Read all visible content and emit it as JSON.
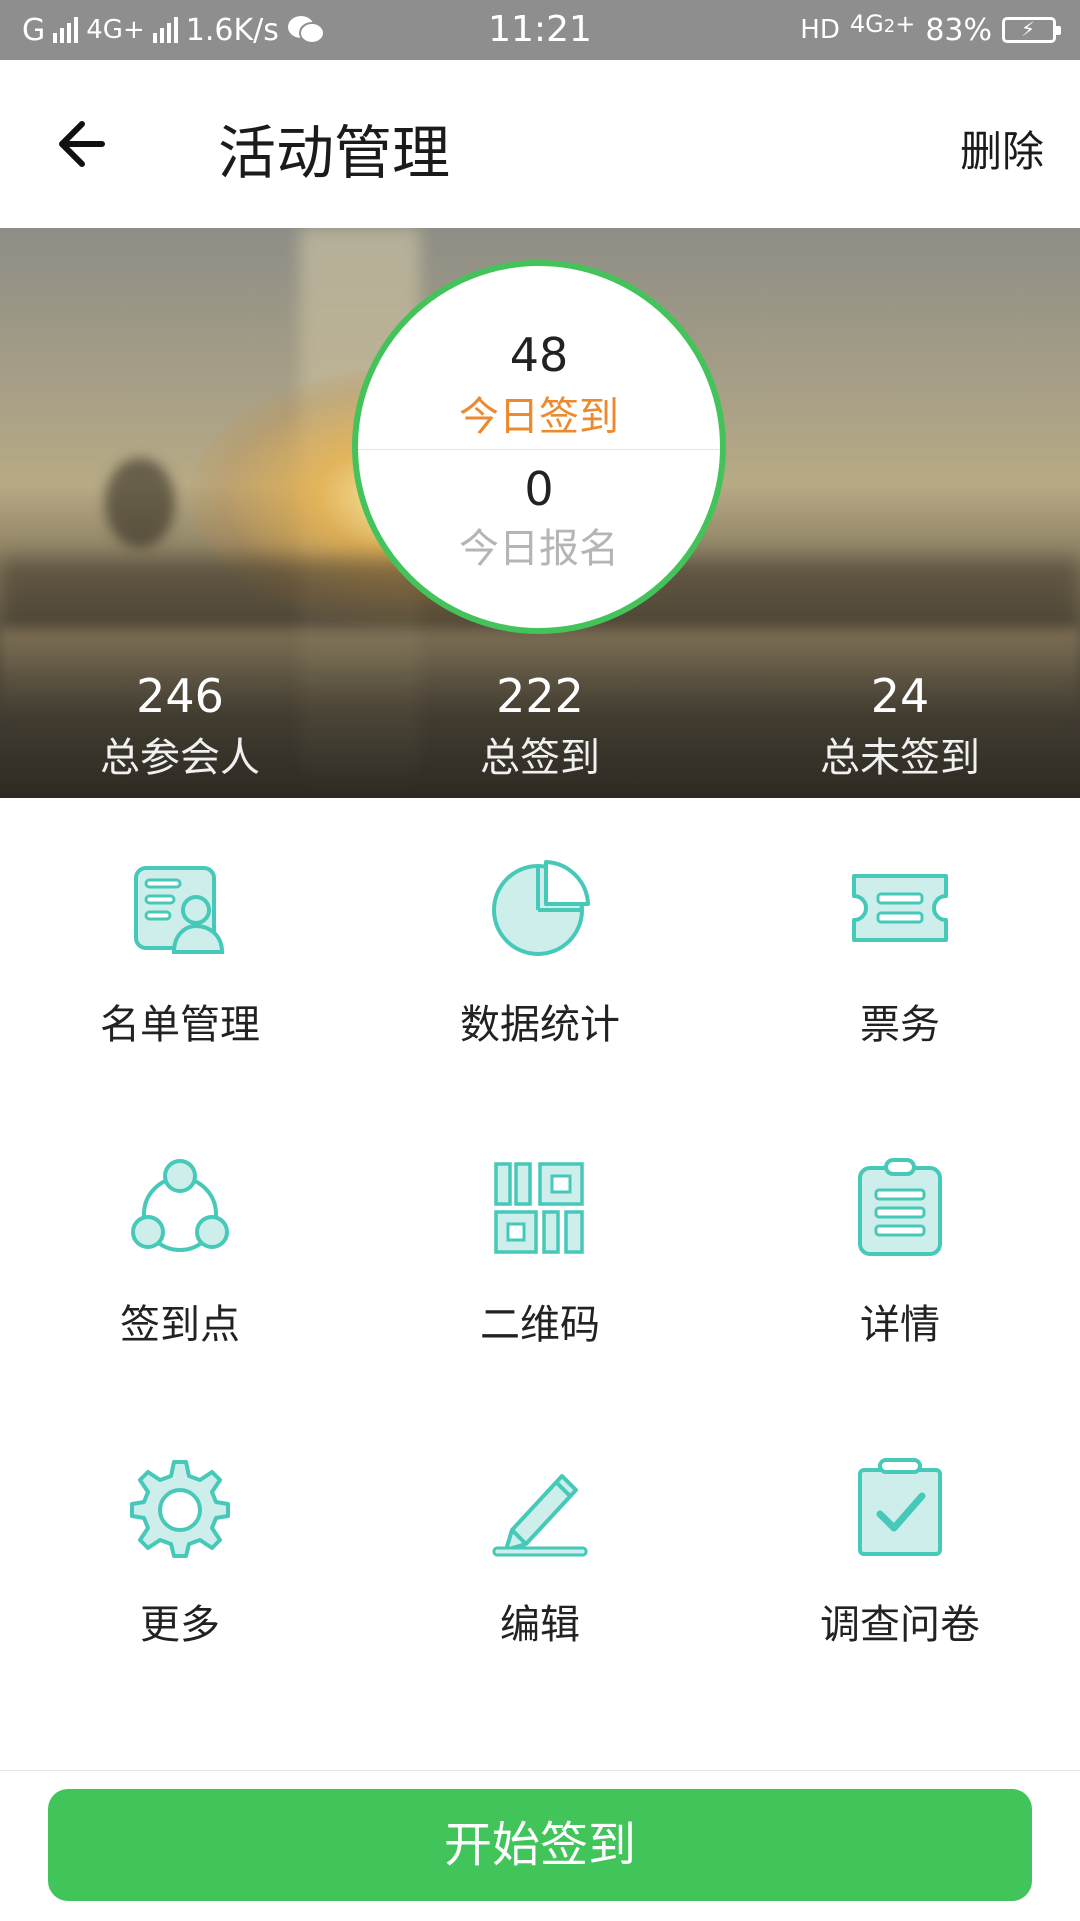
{
  "status_bar": {
    "carrier_left": "G",
    "network_type": "4G+",
    "speed": "1.6K/s",
    "time": "11:21",
    "hd": "HD",
    "network_right": "4G",
    "network_right_sub": "2",
    "network_right_plus": "+",
    "battery": "83%",
    "icons": [
      "signal-icon",
      "wechat-icon",
      "battery-charging-icon"
    ]
  },
  "header": {
    "title": "活动管理",
    "delete_label": "删除",
    "back_icon": "arrow-left-icon"
  },
  "hero": {
    "today_checkin_value": "48",
    "today_checkin_label": "今日签到",
    "today_signup_value": "0",
    "today_signup_label": "今日报名",
    "ring_color": "#45c35b",
    "checkin_label_color": "#ee8a2e",
    "stats": [
      {
        "value": "246",
        "label": "总参会人"
      },
      {
        "value": "222",
        "label": "总签到"
      },
      {
        "value": "24",
        "label": "总未签到"
      }
    ]
  },
  "grid": {
    "icon_color": "#46c9b8",
    "items": [
      {
        "label": "名单管理",
        "icon": "roster-icon"
      },
      {
        "label": "数据统计",
        "icon": "pie-chart-icon"
      },
      {
        "label": "票务",
        "icon": "ticket-icon"
      },
      {
        "label": "签到点",
        "icon": "checkin-points-icon"
      },
      {
        "label": "二维码",
        "icon": "qrcode-icon"
      },
      {
        "label": "详情",
        "icon": "clipboard-details-icon"
      },
      {
        "label": "更多",
        "icon": "gear-icon"
      },
      {
        "label": "编辑",
        "icon": "pencil-icon"
      },
      {
        "label": "调查问卷",
        "icon": "survey-check-icon"
      }
    ]
  },
  "footer": {
    "start_button_label": "开始签到",
    "button_color": "#41c55a"
  }
}
